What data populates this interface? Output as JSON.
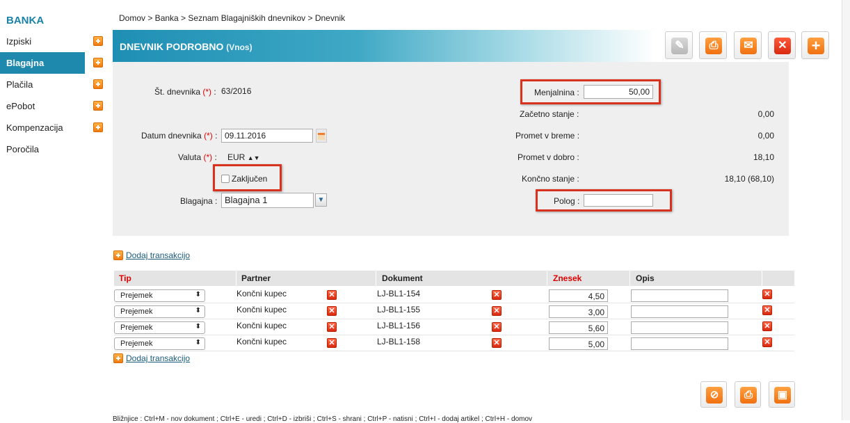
{
  "sidebar": {
    "brand": "BANKA",
    "items": [
      {
        "label": "Izpiski",
        "has_add": true
      },
      {
        "label": "Blagajna",
        "has_add": true,
        "active": true
      },
      {
        "label": "Plačila",
        "has_add": true
      },
      {
        "label": "ePobot",
        "has_add": true
      },
      {
        "label": "Kompenzacija",
        "has_add": true
      },
      {
        "label": "Poročila",
        "has_add": false
      }
    ]
  },
  "breadcrumb": "Domov  >  Banka  >  Seznam Blagajniških dnevnikov  >  Dnevnik",
  "header": {
    "title": "DNEVNIK PODROBNO",
    "subtitle": "(Vnos)"
  },
  "toolbar": {
    "icons": [
      "edit-icon",
      "print-icon",
      "mail-icon",
      "delete-icon",
      "add-icon"
    ]
  },
  "form": {
    "st_dnevnika_label": "Št. dnevnika",
    "st_dnevnika_value": "63/2016",
    "datum_label": "Datum dnevnika",
    "datum_value": "09.11.2016",
    "valuta_label": "Valuta",
    "valuta_value": "EUR",
    "zakljucen_label": "Zaključen",
    "blagajna_label": "Blagajna :",
    "blagajna_value": "Blagajna 1",
    "required_mark": "(*)",
    "colon": " :",
    "menjalnina_label": "Menjalnina :",
    "menjalnina_value": "50,00",
    "zacetno_label": "Začetno stanje :",
    "zacetno_value": "0,00",
    "breme_label": "Promet v breme :",
    "breme_value": "0,00",
    "dobro_label": "Promet v dobro :",
    "dobro_value": "18,10",
    "koncno_label": "Končno stanje :",
    "koncno_value": "18,10 (68,10)",
    "polog_label": "Polog :",
    "polog_value": ""
  },
  "table": {
    "add_link": "Dodaj transakcijo",
    "headers": {
      "tip": "Tip",
      "partner": "Partner",
      "dokument": "Dokument",
      "znesek": "Znesek",
      "opis": "Opis"
    },
    "rows": [
      {
        "tip": "Prejemek",
        "partner": "Končni kupec",
        "dokument": "LJ-BL1-154",
        "znesek": "4,50",
        "opis": ""
      },
      {
        "tip": "Prejemek",
        "partner": "Končni kupec",
        "dokument": "LJ-BL1-155",
        "znesek": "3,00",
        "opis": ""
      },
      {
        "tip": "Prejemek",
        "partner": "Končni kupec",
        "dokument": "LJ-BL1-156",
        "znesek": "5,60",
        "opis": ""
      },
      {
        "tip": "Prejemek",
        "partner": "Končni kupec",
        "dokument": "LJ-BL1-158",
        "znesek": "5,00",
        "opis": ""
      }
    ]
  },
  "bottom_toolbar": {
    "icons": [
      "cancel-icon",
      "print-icon",
      "save-icon"
    ]
  },
  "shortcuts": "Bližnjice : Ctrl+M - nov dokument ; Ctrl+E - uredi ; Ctrl+D - izbriši ; Ctrl+S - shrani ; Ctrl+P - natisni ; Ctrl+I - dodaj artikel ; Ctrl+H - domov",
  "colors": {
    "accent": "#1e89ad",
    "orange": "#f07a10",
    "red": "#d8321f"
  }
}
